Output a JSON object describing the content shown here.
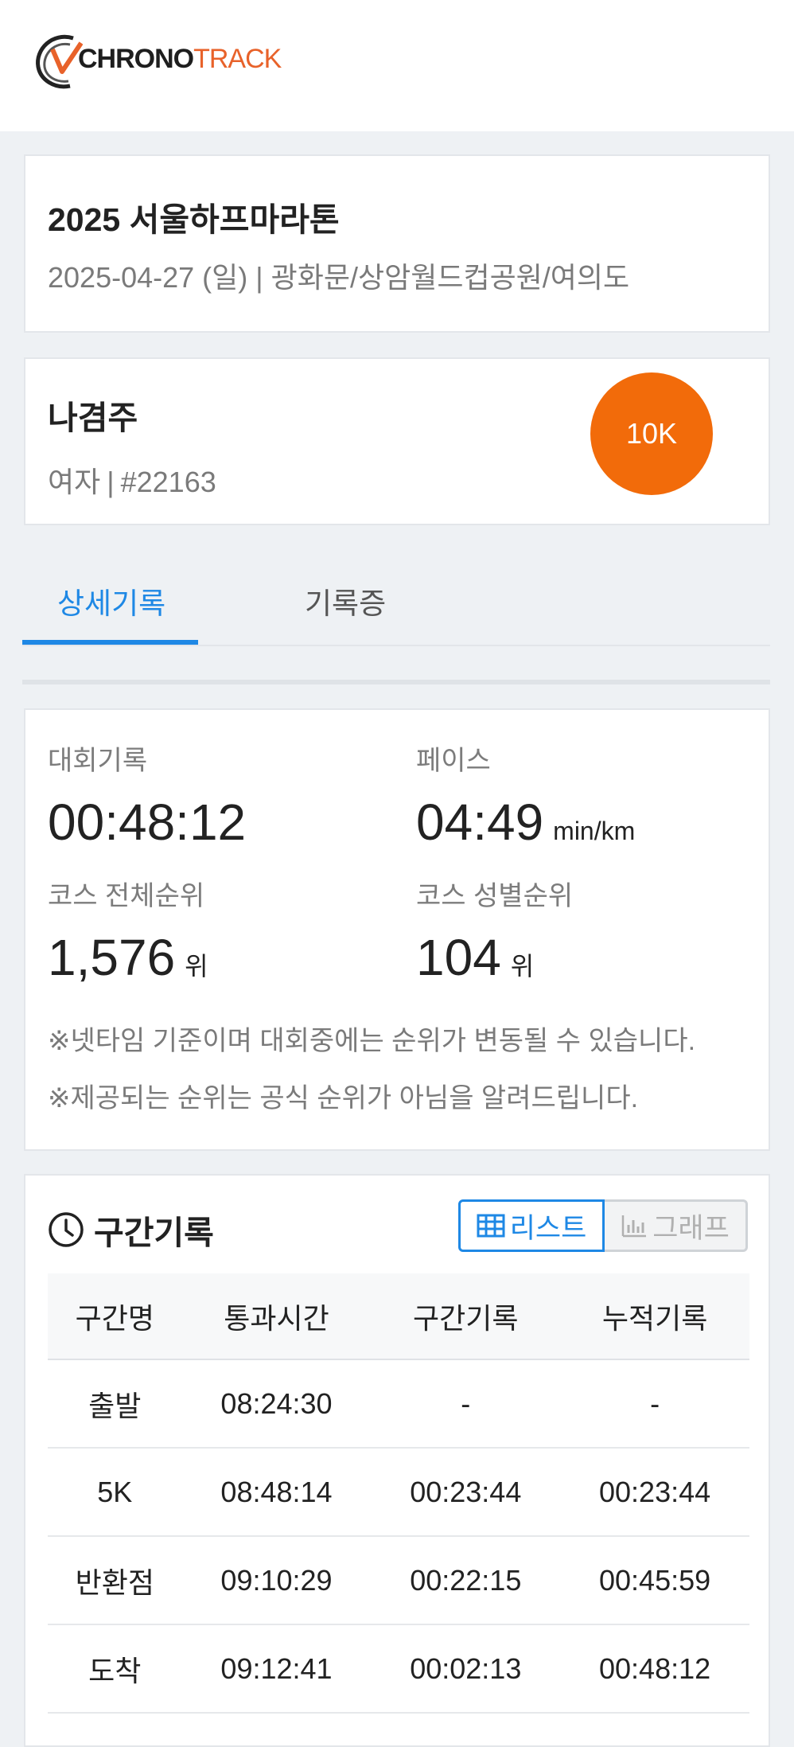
{
  "header": {
    "logo_text_a": "CHRONO",
    "logo_text_b": "TRACK"
  },
  "event": {
    "title": "2025 서울하프마라톤",
    "subtitle": "2025-04-27 (일) | 광화문/상암월드컵공원/여의도"
  },
  "runner": {
    "name": "나겸주",
    "gender": "여자",
    "separator": "|",
    "bib": "#22163",
    "course": "10K"
  },
  "tabs": [
    {
      "label": "상세기록"
    },
    {
      "label": "기록증"
    }
  ],
  "summary": {
    "record_label": "대회기록",
    "record_value": "00:48:12",
    "pace_label": "페이스",
    "pace_value": "04:49",
    "pace_unit": "min/km",
    "overall_rank_label": "코스 전체순위",
    "overall_rank_value": "1,576",
    "gender_rank_label": "코스 성별순위",
    "gender_rank_value": "104",
    "rank_unit": "위",
    "note1": "※넷타임 기준이며 대회중에는 순위가 변동될 수 있습니다.",
    "note2": "※제공되는 순위는 공식 순위가 아님을 알려드립니다."
  },
  "splits": {
    "title": "구간기록",
    "view_list_label": "리스트",
    "view_graph_label": "그래프",
    "columns": [
      "구간명",
      "통과시간",
      "구간기록",
      "누적기록"
    ],
    "rows": [
      [
        "출발",
        "08:24:30",
        "-",
        "-"
      ],
      [
        "5K",
        "08:48:14",
        "00:23:44",
        "00:23:44"
      ],
      [
        "반환점",
        "09:10:29",
        "00:22:15",
        "00:45:59"
      ],
      [
        "도착",
        "09:12:41",
        "00:02:13",
        "00:48:12"
      ]
    ]
  },
  "colors": {
    "accent": "#1e88e5",
    "badge": "#f26b0a",
    "logo_orange": "#e8622a"
  }
}
